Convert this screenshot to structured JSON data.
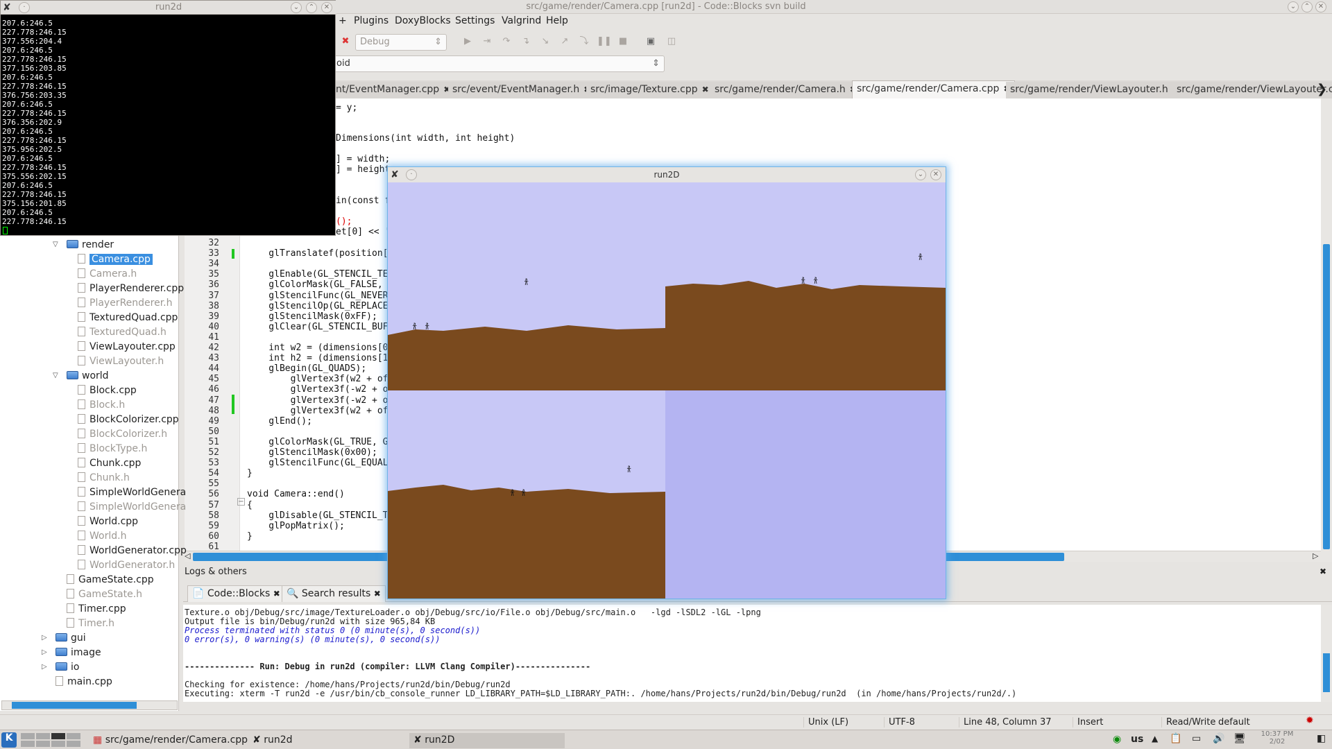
{
  "window": {
    "title": "src/game/render/Camera.cpp [run2d] - Code::Blocks svn build"
  },
  "menu": [
    "+",
    "Plugins",
    "DoxyBlocks",
    "Settings",
    "Valgrind",
    "Help"
  ],
  "toolbar": {
    "build_target": "Debug",
    "scope_combo": "oid"
  },
  "tabs": [
    {
      "label": "nt/EventManager.cpp"
    },
    {
      "label": "src/event/EventManager.h"
    },
    {
      "label": "src/image/Texture.cpp"
    },
    {
      "label": "src/game/render/Camera.h"
    },
    {
      "label": "src/game/render/Camera.cpp",
      "active": true
    },
    {
      "label": "src/game/render/ViewLayouter.h"
    },
    {
      "label": "src/game/render/ViewLayouter.c"
    }
  ],
  "code_top": [
    {
      "text": "= y;"
    },
    {
      "text": "Dimensions(int width, int height)"
    },
    {
      "text": "] = width;"
    },
    {
      "text": "] = height"
    },
    {
      "text": "in(const f"
    },
    {
      "text": "();"
    },
    {
      "text": "et[0] << '"
    }
  ],
  "code_lines": [
    {
      "n": "32",
      "text": ""
    },
    {
      "n": "33",
      "text": "    glTranslatef(position["
    },
    {
      "n": "34",
      "text": ""
    },
    {
      "n": "35",
      "text": "    glEnable(GL_STENCIL_TE"
    },
    {
      "n": "36",
      "text": "    glColorMask(GL_FALSE,"
    },
    {
      "n": "37",
      "text": "    glStencilFunc(GL_NEVER"
    },
    {
      "n": "38",
      "text": "    glStencilOp(GL_REPLACE"
    },
    {
      "n": "39",
      "text": "    glStencilMask(0xFF);"
    },
    {
      "n": "40",
      "text": "    glClear(GL_STENCIL_BUF"
    },
    {
      "n": "41",
      "text": ""
    },
    {
      "n": "42",
      "text": "    int w2 = (dimensions[0"
    },
    {
      "n": "43",
      "text": "    int h2 = (dimensions[1"
    },
    {
      "n": "44",
      "text": "    glBegin(GL_QUADS);"
    },
    {
      "n": "45",
      "text": "        glVertex3f(w2 + of"
    },
    {
      "n": "46",
      "text": "        glVertex3f(-w2 + o"
    },
    {
      "n": "47",
      "text": "        glVertex3f(-w2 + o"
    },
    {
      "n": "48",
      "text": "        glVertex3f(w2 + of"
    },
    {
      "n": "49",
      "text": "    glEnd();"
    },
    {
      "n": "50",
      "text": ""
    },
    {
      "n": "51",
      "text": "    glColorMask(GL_TRUE, G"
    },
    {
      "n": "52",
      "text": "    glStencilMask(0x00);"
    },
    {
      "n": "53",
      "text": "    glStencilFunc(GL_EQUAL"
    },
    {
      "n": "54",
      "text": "}"
    },
    {
      "n": "55",
      "text": ""
    },
    {
      "n": "56",
      "text": "void Camera::end()"
    },
    {
      "n": "57",
      "text": "{"
    },
    {
      "n": "58",
      "text": "    glDisable(GL_STENCIL_T"
    },
    {
      "n": "59",
      "text": "    glPopMatrix();"
    },
    {
      "n": "60",
      "text": "}"
    },
    {
      "n": "61",
      "text": ""
    }
  ],
  "tree": [
    {
      "label": "render",
      "type": "folder"
    },
    {
      "label": "Camera.cpp",
      "type": "file",
      "selected": true
    },
    {
      "label": "Camera.h",
      "type": "header"
    },
    {
      "label": "PlayerRenderer.cpp",
      "type": "file"
    },
    {
      "label": "PlayerRenderer.h",
      "type": "header"
    },
    {
      "label": "TexturedQuad.cpp",
      "type": "file"
    },
    {
      "label": "TexturedQuad.h",
      "type": "header"
    },
    {
      "label": "ViewLayouter.cpp",
      "type": "file"
    },
    {
      "label": "ViewLayouter.h",
      "type": "header"
    },
    {
      "label": "world",
      "type": "folder"
    },
    {
      "label": "Block.cpp",
      "type": "file"
    },
    {
      "label": "Block.h",
      "type": "header"
    },
    {
      "label": "BlockColorizer.cpp",
      "type": "file"
    },
    {
      "label": "BlockColorizer.h",
      "type": "header"
    },
    {
      "label": "BlockType.h",
      "type": "header"
    },
    {
      "label": "Chunk.cpp",
      "type": "file"
    },
    {
      "label": "Chunk.h",
      "type": "header"
    },
    {
      "label": "SimpleWorldGenera",
      "type": "file"
    },
    {
      "label": "SimpleWorldGenera",
      "type": "header"
    },
    {
      "label": "World.cpp",
      "type": "file"
    },
    {
      "label": "World.h",
      "type": "header"
    },
    {
      "label": "WorldGenerator.cpp",
      "type": "file"
    },
    {
      "label": "WorldGenerator.h",
      "type": "header"
    },
    {
      "label": "GameState.cpp",
      "type": "file"
    },
    {
      "label": "GameState.h",
      "type": "header"
    },
    {
      "label": "Timer.cpp",
      "type": "file"
    },
    {
      "label": "Timer.h",
      "type": "header"
    },
    {
      "label": "gui",
      "type": "folder"
    },
    {
      "label": "image",
      "type": "folder"
    },
    {
      "label": "io",
      "type": "folder"
    },
    {
      "label": "main.cpp",
      "type": "file"
    }
  ],
  "logs": {
    "header": "Logs & others",
    "tabs": [
      "Code::Blocks",
      "Search results"
    ],
    "lines": [
      "Texture.o obj/Debug/src/image/TextureLoader.o obj/Debug/src/io/File.o obj/Debug/src/main.o   -lgd -lSDL2 -lGL -lpng",
      "Output file is bin/Debug/run2d with size 965,84 KB",
      "Process terminated with status 0 (0 minute(s), 0 second(s))",
      "0 error(s), 0 warning(s) (0 minute(s), 0 second(s))",
      "",
      "",
      "-------------- Run: Debug in run2d (compiler: LLVM Clang Compiler)---------------",
      "",
      "Checking for existence: /home/hans/Projects/run2d/bin/Debug/run2d",
      "Executing: xterm -T run2d -e /usr/bin/cb_console_runner LD_LIBRARY_PATH=$LD_LIBRARY_PATH:. /home/hans/Projects/run2d/bin/Debug/run2d  (in /home/hans/Projects/run2d/.)"
    ]
  },
  "status": {
    "eol": "Unix (LF)",
    "encoding": "UTF-8",
    "position": "Line 48, Column 37",
    "mode": "Insert",
    "rw": "Read/Write",
    "lang": "default"
  },
  "taskbar": {
    "items": [
      "src/game/render/Camera.cpp",
      "run2d",
      "run2D"
    ],
    "kbd": "us",
    "time": "10:37 PM",
    "date": "2/02"
  },
  "terminal": {
    "title": "run2d",
    "lines": [
      "207.6:246.5",
      "227.778:246.15",
      "377.556:204.4",
      "207.6:246.5",
      "227.778:246.15",
      "377.156:203.85",
      "207.6:246.5",
      "227.778:246.15",
      "376.756:203.35",
      "207.6:246.5",
      "227.778:246.15",
      "376.356:202.9",
      "207.6:246.5",
      "227.778:246.15",
      "375.956:202.5",
      "207.6:246.5",
      "227.778:246.15",
      "375.556:202.15",
      "207.6:246.5",
      "227.778:246.15",
      "375.156:201.85",
      "207.6:246.5",
      "227.778:246.15"
    ]
  },
  "game": {
    "title": "run2D",
    "sky": "#c8c8f6",
    "sky_empty": "#b4b4f2",
    "ground": "#7a4a1e"
  }
}
